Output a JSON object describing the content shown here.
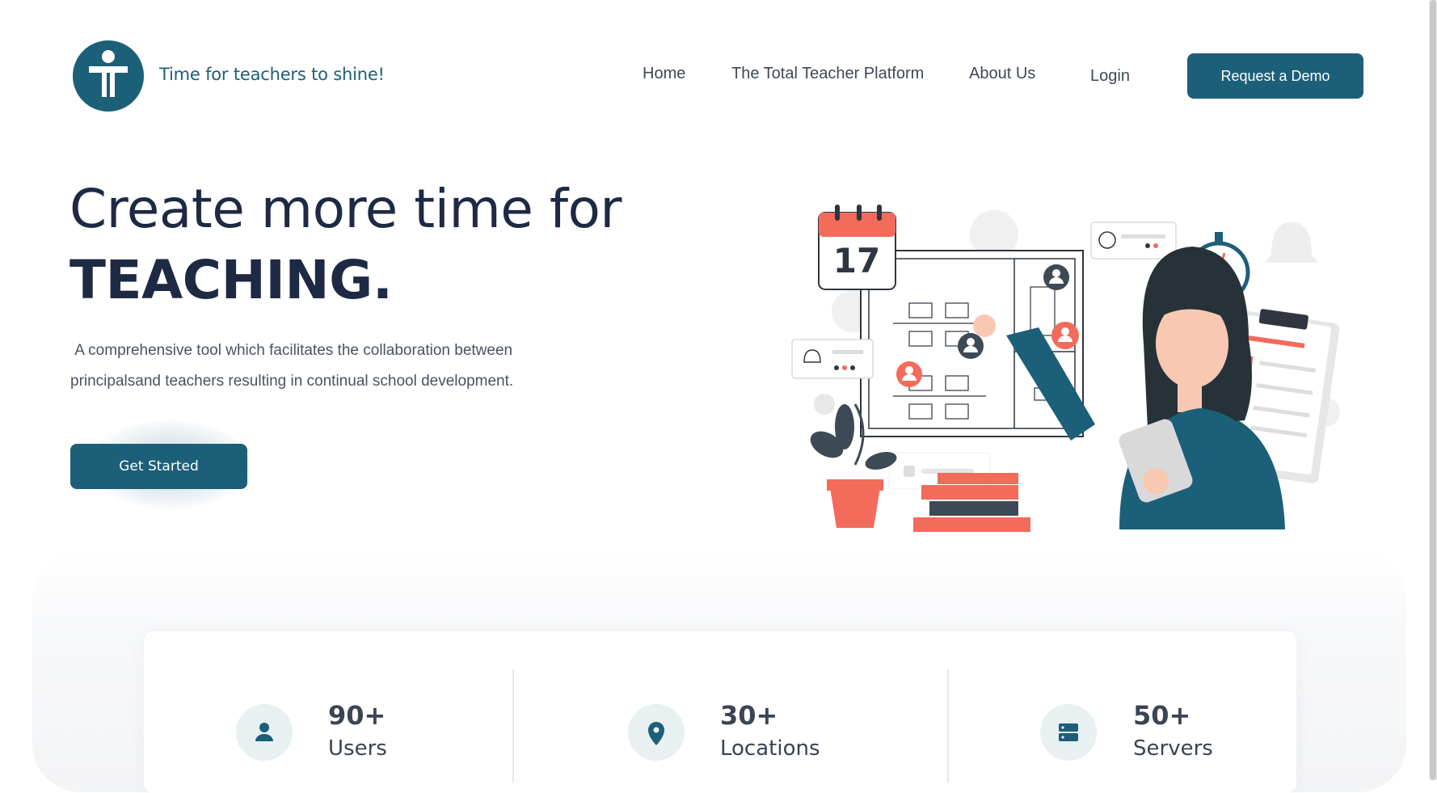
{
  "header": {
    "tagline": "Time for teachers to shine!",
    "nav": {
      "home": "Home",
      "platform": "The Total Teacher Platform",
      "about": "About Us",
      "login": "Login"
    },
    "demo_label": "Request a Demo"
  },
  "hero": {
    "line1": "Create more time for",
    "line2": "TEACHING.",
    "description": " A comprehensive tool which facilitates the collaboration between\nprincipalsand teachers resulting in continual school development.",
    "cta_label": "Get Started"
  },
  "illustration": {
    "calendar_day": "17"
  },
  "stats": [
    {
      "value": "90+",
      "label": "Users",
      "icon": "user-icon"
    },
    {
      "value": "30+",
      "label": "Locations",
      "icon": "location-pin-icon"
    },
    {
      "value": "50+",
      "label": "Servers",
      "icon": "server-icon"
    }
  ],
  "colors": {
    "brand": "#1c5f78",
    "heading": "#1e2a44",
    "accent": "#f26b5b"
  }
}
